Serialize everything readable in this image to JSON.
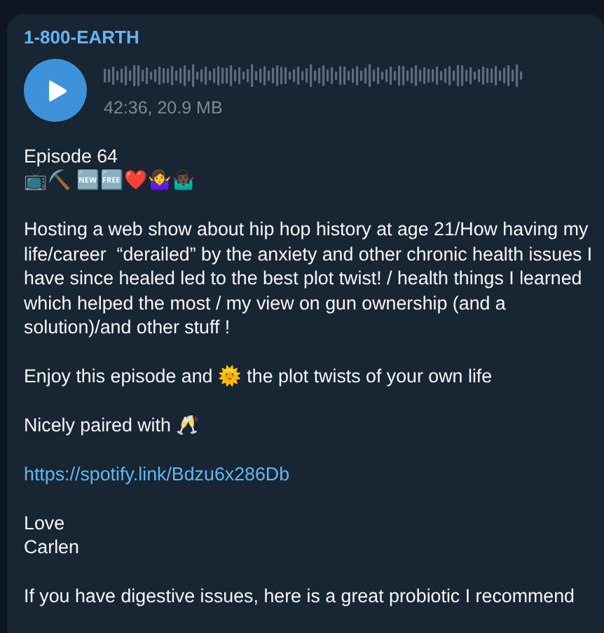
{
  "message": {
    "sender": "1-800-EARTH",
    "audio": {
      "meta": "42:36, 20.9 MB"
    },
    "blocks": [
      {
        "kind": "lines",
        "lines": [
          "Episode 64",
          "📺⛏️ 🆕🆓❤️🤷‍♀️🤷🏿‍♂️"
        ]
      },
      {
        "kind": "text",
        "text": "Hosting a web show about hip hop history at age 21/How having my life/career  “derailed” by the anxiety and other chronic health issues I have since healed led to the best plot twist! / health things I learned which helped the most / my view on gun ownership (and a solution)/and other stuff !"
      },
      {
        "kind": "text",
        "text": "Enjoy this episode and 🌞 the plot twists of your own life"
      },
      {
        "kind": "text",
        "text": "Nicely paired with 🥂"
      },
      {
        "kind": "link",
        "text": "https://spotify.link/Bdzu6x286Db"
      },
      {
        "kind": "lines",
        "lines": [
          "Love",
          "Carlen"
        ]
      },
      {
        "kind": "text",
        "text": "If you have digestive issues, here is a great probiotic I recommend"
      }
    ]
  }
}
